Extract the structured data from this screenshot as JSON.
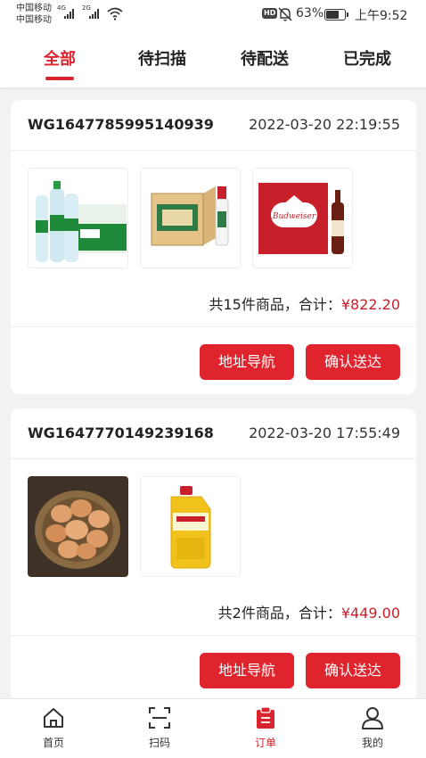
{
  "status_bar": {
    "carrier_1": "中国移动",
    "carrier_2": "中国移动",
    "network_1": "4G",
    "network_2": "2G",
    "hd_badge": "HD",
    "battery_percent": "63%",
    "battery_level": 0.63,
    "time": "上午9:52"
  },
  "tabs": [
    {
      "label": "全部",
      "active": true
    },
    {
      "label": "待扫描",
      "active": false
    },
    {
      "label": "待配送",
      "active": false
    },
    {
      "label": "已完成",
      "active": false
    }
  ],
  "orders": [
    {
      "order_no": "WG1647785995140939",
      "time": "2022-03-20 22:19:55",
      "products": [
        "water-bottle-pack",
        "liquor-carton",
        "beer-case"
      ],
      "summary_prefix": "共15件商品，合计：",
      "total": "¥822.20",
      "brand_text": "Budweiser",
      "buttons": {
        "navigate": "地址导航",
        "confirm": "确认送达"
      }
    },
    {
      "order_no": "WG1647770149239168",
      "time": "2022-03-20 17:55:49",
      "products": [
        "eggs-basket",
        "cooking-oil-jug"
      ],
      "summary_prefix": "共2件商品，合计：",
      "total": "¥449.00",
      "buttons": {
        "navigate": "地址导航",
        "confirm": "确认送达"
      }
    }
  ],
  "bottom_nav": [
    {
      "label": "首页",
      "icon": "home-icon",
      "active": false
    },
    {
      "label": "扫码",
      "icon": "scan-icon",
      "active": false
    },
    {
      "label": "订单",
      "icon": "order-clipboard-icon",
      "active": true
    },
    {
      "label": "我的",
      "icon": "user-icon",
      "active": false
    }
  ],
  "colors": {
    "accent": "#d9232d",
    "background": "#f2f2f2"
  }
}
